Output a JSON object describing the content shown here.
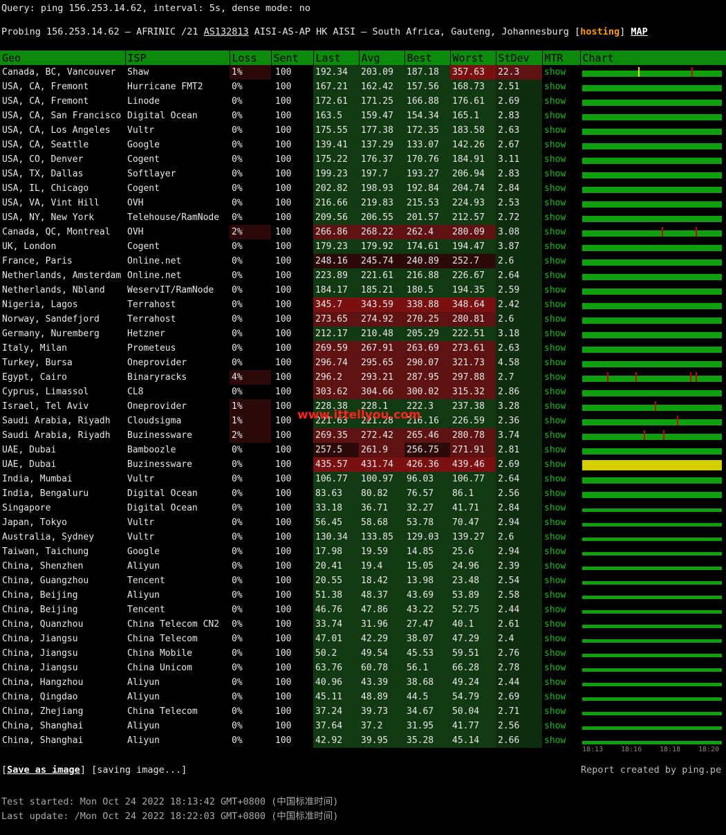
{
  "query_line": "Query: ping 156.253.14.62, interval: 5s, dense mode: no",
  "probe": {
    "prefix": "Probing 156.253.14.62 — AFRINIC /21 ",
    "asn": "AS132813",
    "middle": " AISI-AS-AP HK AISI — South Africa, Gauteng, Johannesburg [",
    "hosting": "hosting",
    "close": "] ",
    "map": "MAP"
  },
  "headers": [
    "Geo",
    "ISP",
    "Loss",
    "Sent",
    "Last",
    "Avg",
    "Best",
    "Worst",
    "StDev",
    "MTR",
    "Chart"
  ],
  "colors": {
    "header_green": "#0b8a0b",
    "mtr_link": "#16c016",
    "bar_green": "#0fa00f",
    "spike_red": "#d00000",
    "hosting_orange": "#ff9900",
    "warning_yellow": "#d6cf00"
  },
  "rows": [
    [
      "Canada, BC, Vancouver",
      "Shaw",
      "1%",
      "100",
      "192.34",
      "203.09",
      "187.18",
      "357.63",
      "22.3",
      "show"
    ],
    [
      "USA, CA, Fremont",
      "Hurricane FMT2",
      "0%",
      "100",
      "167.21",
      "162.42",
      "157.56",
      "168.73",
      "2.51",
      "show"
    ],
    [
      "USA, CA, Fremont",
      "Linode",
      "0%",
      "100",
      "172.61",
      "171.25",
      "166.88",
      "176.61",
      "2.69",
      "show"
    ],
    [
      "USA, CA, San Francisco",
      "Digital Ocean",
      "0%",
      "100",
      "163.5",
      "159.47",
      "154.34",
      "165.1",
      "2.83",
      "show"
    ],
    [
      "USA, CA, Los Angeles",
      "Vultr",
      "0%",
      "100",
      "175.55",
      "177.38",
      "172.35",
      "183.58",
      "2.63",
      "show"
    ],
    [
      "USA, CA, Seattle",
      "Google",
      "0%",
      "100",
      "139.41",
      "137.29",
      "133.07",
      "142.26",
      "2.67",
      "show"
    ],
    [
      "USA, CO, Denver",
      "Cogent",
      "0%",
      "100",
      "175.22",
      "176.37",
      "170.76",
      "184.91",
      "3.11",
      "show"
    ],
    [
      "USA, TX, Dallas",
      "Softlayer",
      "0%",
      "100",
      "199.23",
      "197.7",
      "193.27",
      "206.94",
      "2.83",
      "show"
    ],
    [
      "USA, IL, Chicago",
      "Cogent",
      "0%",
      "100",
      "202.82",
      "198.93",
      "192.84",
      "204.74",
      "2.84",
      "show"
    ],
    [
      "USA, VA, Vint Hill",
      "OVH",
      "0%",
      "100",
      "216.66",
      "219.83",
      "215.53",
      "224.93",
      "2.53",
      "show"
    ],
    [
      "USA, NY, New York",
      "Telehouse/RamNode",
      "0%",
      "100",
      "209.56",
      "206.55",
      "201.57",
      "212.57",
      "2.72",
      "show"
    ],
    [
      "Canada, QC, Montreal",
      "OVH",
      "2%",
      "100",
      "266.86",
      "268.22",
      "262.4",
      "280.09",
      "3.08",
      "show"
    ],
    [
      "UK, London",
      "Cogent",
      "0%",
      "100",
      "179.23",
      "179.92",
      "174.61",
      "194.47",
      "3.87",
      "show"
    ],
    [
      "France, Paris",
      "Online.net",
      "0%",
      "100",
      "248.16",
      "245.74",
      "240.89",
      "252.7",
      "2.6",
      "show"
    ],
    [
      "Netherlands, Amsterdam",
      "Online.net",
      "0%",
      "100",
      "223.89",
      "221.61",
      "216.88",
      "226.67",
      "2.64",
      "show"
    ],
    [
      "Netherlands, Nbland",
      "WeservIT/RamNode",
      "0%",
      "100",
      "184.17",
      "185.21",
      "180.5",
      "194.35",
      "2.59",
      "show"
    ],
    [
      "Nigeria, Lagos",
      "Terrahost",
      "0%",
      "100",
      "345.7",
      "343.59",
      "338.88",
      "348.64",
      "2.42",
      "show"
    ],
    [
      "Norway, Sandefjord",
      "Terrahost",
      "0%",
      "100",
      "273.65",
      "274.92",
      "270.25",
      "280.81",
      "2.6",
      "show"
    ],
    [
      "Germany, Nuremberg",
      "Hetzner",
      "0%",
      "100",
      "212.17",
      "210.48",
      "205.29",
      "222.51",
      "3.18",
      "show"
    ],
    [
      "Italy, Milan",
      "Prometeus",
      "0%",
      "100",
      "269.59",
      "267.91",
      "263.69",
      "273.61",
      "2.63",
      "show"
    ],
    [
      "Turkey, Bursa",
      "Oneprovider",
      "0%",
      "100",
      "296.74",
      "295.65",
      "290.07",
      "321.73",
      "4.58",
      "show"
    ],
    [
      "Egypt, Cairo",
      "Binaryracks",
      "4%",
      "100",
      "296.2",
      "293.21",
      "287.95",
      "297.88",
      "2.7",
      "show"
    ],
    [
      "Cyprus, Limassol",
      "CL8",
      "0%",
      "100",
      "303.62",
      "304.66",
      "300.02",
      "315.32",
      "2.86",
      "show"
    ],
    [
      "Israel, Tel Aviv",
      "Oneprovider",
      "1%",
      "100",
      "228.38",
      "228.1",
      "222.3",
      "237.38",
      "3.28",
      "show"
    ],
    [
      "Saudi Arabia, Riyadh",
      "Cloudsigma",
      "1%",
      "100",
      "221.63",
      "221.28",
      "216.16",
      "226.59",
      "2.36",
      "show"
    ],
    [
      "Saudi Arabia, Riyadh",
      "Buzinessware",
      "2%",
      "100",
      "269.35",
      "272.42",
      "265.46",
      "280.78",
      "3.74",
      "show"
    ],
    [
      "UAE, Dubai",
      "Bamboozle",
      "0%",
      "100",
      "257.5",
      "261.9",
      "256.75",
      "271.91",
      "2.81",
      "show"
    ],
    [
      "UAE, Dubai",
      "Buzinessware",
      "0%",
      "100",
      "435.57",
      "431.74",
      "426.36",
      "439.46",
      "2.69",
      "show"
    ],
    [
      "India, Mumbai",
      "Vultr",
      "0%",
      "100",
      "106.77",
      "100.97",
      "96.03",
      "106.77",
      "2.64",
      "show"
    ],
    [
      "India, Bengaluru",
      "Digital Ocean",
      "0%",
      "100",
      "83.63",
      "80.82",
      "76.57",
      "86.1",
      "2.56",
      "show"
    ],
    [
      "Singapore",
      "Digital Ocean",
      "0%",
      "100",
      "33.18",
      "36.71",
      "32.27",
      "41.71",
      "2.84",
      "show"
    ],
    [
      "Japan, Tokyo",
      "Vultr",
      "0%",
      "100",
      "56.45",
      "58.68",
      "53.78",
      "70.47",
      "2.94",
      "show"
    ],
    [
      "Australia, Sydney",
      "Vultr",
      "0%",
      "100",
      "130.34",
      "133.85",
      "129.03",
      "139.27",
      "2.6",
      "show"
    ],
    [
      "Taiwan, Taichung",
      "Google",
      "0%",
      "100",
      "17.98",
      "19.59",
      "14.85",
      "25.6",
      "2.94",
      "show"
    ],
    [
      "China, Shenzhen",
      "Aliyun",
      "0%",
      "100",
      "20.41",
      "19.4",
      "15.05",
      "24.96",
      "2.39",
      "show"
    ],
    [
      "China, Guangzhou",
      "Tencent",
      "0%",
      "100",
      "20.55",
      "18.42",
      "13.98",
      "23.48",
      "2.54",
      "show"
    ],
    [
      "China, Beijing",
      "Aliyun",
      "0%",
      "100",
      "51.38",
      "48.37",
      "43.69",
      "53.89",
      "2.58",
      "show"
    ],
    [
      "China, Beijing",
      "Tencent",
      "0%",
      "100",
      "46.76",
      "47.86",
      "43.22",
      "52.75",
      "2.44",
      "show"
    ],
    [
      "China, Quanzhou",
      "China Telecom CN2",
      "0%",
      "100",
      "33.74",
      "31.96",
      "27.47",
      "40.1",
      "2.61",
      "show"
    ],
    [
      "China, Jiangsu",
      "China Telecom",
      "0%",
      "100",
      "47.01",
      "42.29",
      "38.07",
      "47.29",
      "2.4",
      "show"
    ],
    [
      "China, Jiangsu",
      "China Mobile",
      "0%",
      "100",
      "50.2",
      "49.54",
      "45.53",
      "59.51",
      "2.76",
      "show"
    ],
    [
      "China, Jiangsu",
      "China Unicom",
      "0%",
      "100",
      "63.76",
      "60.78",
      "56.1",
      "66.28",
      "2.78",
      "show"
    ],
    [
      "China, Hangzhou",
      "Aliyun",
      "0%",
      "100",
      "40.96",
      "43.39",
      "38.68",
      "49.24",
      "2.44",
      "show"
    ],
    [
      "China, Qingdao",
      "Aliyun",
      "0%",
      "100",
      "45.11",
      "48.89",
      "44.5",
      "54.79",
      "2.69",
      "show"
    ],
    [
      "China, Zhejiang",
      "China Telecom",
      "0%",
      "100",
      "37.24",
      "39.73",
      "34.67",
      "50.04",
      "2.71",
      "show"
    ],
    [
      "China, Shanghai",
      "Aliyun",
      "0%",
      "100",
      "37.64",
      "37.2",
      "31.95",
      "41.77",
      "2.56",
      "show"
    ],
    [
      "China, Shanghai",
      "Aliyun",
      "0%",
      "100",
      "42.92",
      "39.95",
      "35.28",
      "45.14",
      "2.66",
      "show"
    ]
  ],
  "axis_ticks": [
    "18:13",
    "18:16",
    "18:18",
    "18:20"
  ],
  "footer": {
    "save_open": "[",
    "save_label": "Save as image",
    "save_close": "] [saving image...]",
    "report": "Report created by ping.pe",
    "started": "Test started: Mon Oct 24 2022 18:13:42 GMT+0800 (中国标准时间)",
    "updated": "Last update: /Mon Oct 24 2022 18:22:03 GMT+0800 (中国标准时间)"
  },
  "watermark": "www.ittellyou.com"
}
